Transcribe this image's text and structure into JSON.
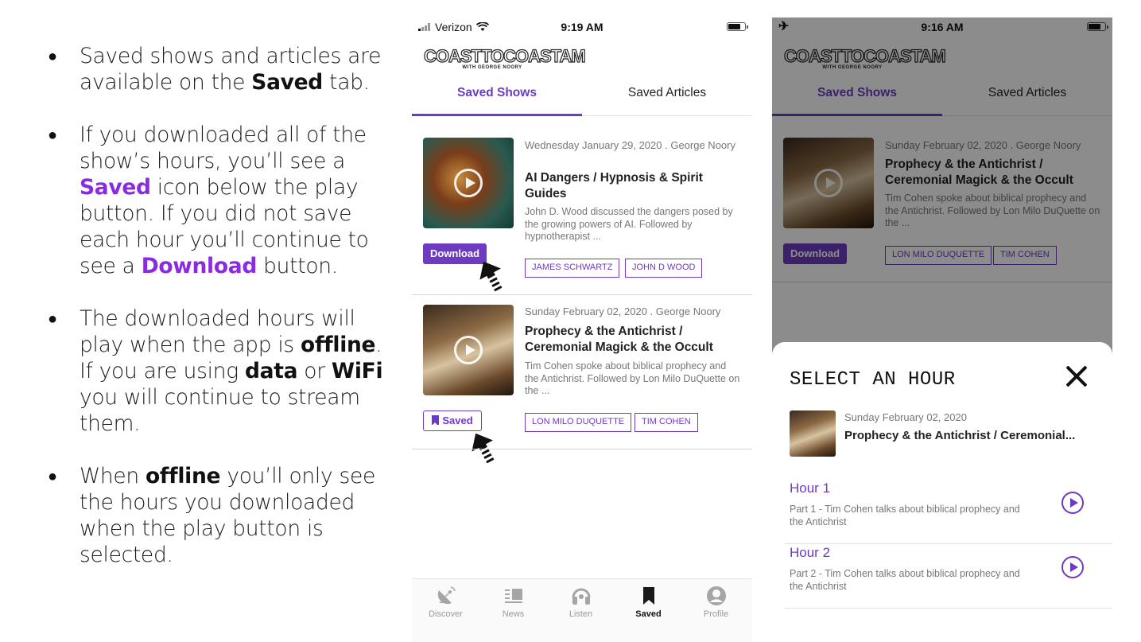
{
  "bullets": [
    {
      "parts": [
        "Saved shows and articles are available on the ",
        "Saved",
        " tab."
      ]
    },
    {
      "parts": [
        "If you downloaded all of the show’s hours, you’ll see a ",
        "Saved",
        " icon below the play button. If you did not save each hour you’ll continue to see a ",
        "Download",
        " button."
      ]
    },
    {
      "parts": [
        "The downloaded hours will play when the app is ",
        "offline",
        ". If you are using ",
        "data",
        " or ",
        "WiFi",
        " you will continue to stream them."
      ]
    },
    {
      "parts": [
        "When ",
        "offline",
        " you’ll only see the hours you downloaded when the play button is selected."
      ]
    }
  ],
  "phone1": {
    "status": {
      "carrier": "Verizon",
      "time": "9:19 AM"
    },
    "logo": {
      "title": "COASTTOCOASTAM",
      "subtitle": "WITH GEORGE NOORY"
    },
    "tabs": [
      "Saved Shows",
      "Saved Articles"
    ],
    "shows": [
      {
        "meta": "Wednesday January 29, 2020 . George Noory",
        "title": "AI Dangers / Hypnosis & Spirit Guides",
        "desc": "John D. Wood discussed the dangers posed by the growing powers of AI. Followed by hypnotherapist ...",
        "button": "Download",
        "tags": [
          "JAMES SCHWARTZ",
          "JOHN D WOOD"
        ]
      },
      {
        "meta": "Sunday February 02, 2020 . George Noory",
        "title": "Prophecy & the Antichrist / Ceremonial Magick & the Occult",
        "desc": "Tim Cohen spoke about biblical prophecy and the Antichrist. Followed by Lon Milo DuQuette on the ...",
        "button": "Saved",
        "tags": [
          "LON MILO DUQUETTE",
          "TIM COHEN"
        ]
      }
    ],
    "nav": [
      {
        "label": "Discover",
        "icon": "satellite-dish-icon"
      },
      {
        "label": "News",
        "icon": "news-icon"
      },
      {
        "label": "Listen",
        "icon": "headphones-icon"
      },
      {
        "label": "Saved",
        "icon": "bookmark-icon"
      },
      {
        "label": "Profile",
        "icon": "profile-icon"
      }
    ]
  },
  "phone2": {
    "status": {
      "time": "9:16 AM"
    },
    "logo": {
      "title": "COASTTOCOASTAM",
      "subtitle": "WITH GEORGE NOORY"
    },
    "tabs": [
      "Saved Shows",
      "Saved Articles"
    ],
    "show": {
      "meta": "Sunday February 02, 2020 . George Noory",
      "title": "Prophecy & the Antichrist / Ceremonial Magick & the Occult",
      "desc": "Tim Cohen spoke about biblical prophecy and the Antichrist. Followed by Lon Milo DuQuette on the ...",
      "button": "Download",
      "tags": [
        "LON MILO DUQUETTE",
        "TIM COHEN"
      ]
    },
    "sheet": {
      "title": "SELECT AN HOUR",
      "episode_date": "Sunday February 02, 2020",
      "episode_title": "Prophecy & the Antichrist / Ceremonial...",
      "hours": [
        {
          "title": "Hour 1",
          "desc": "Part 1 - Tim Cohen talks about biblical prophecy and the Antichrist"
        },
        {
          "title": "Hour 2",
          "desc": "Part 2 - Tim Cohen talks about biblical prophecy and the Antichrist"
        }
      ]
    }
  },
  "colors": {
    "accent": "#6d3bc2",
    "highlight": "#8a2be2"
  }
}
